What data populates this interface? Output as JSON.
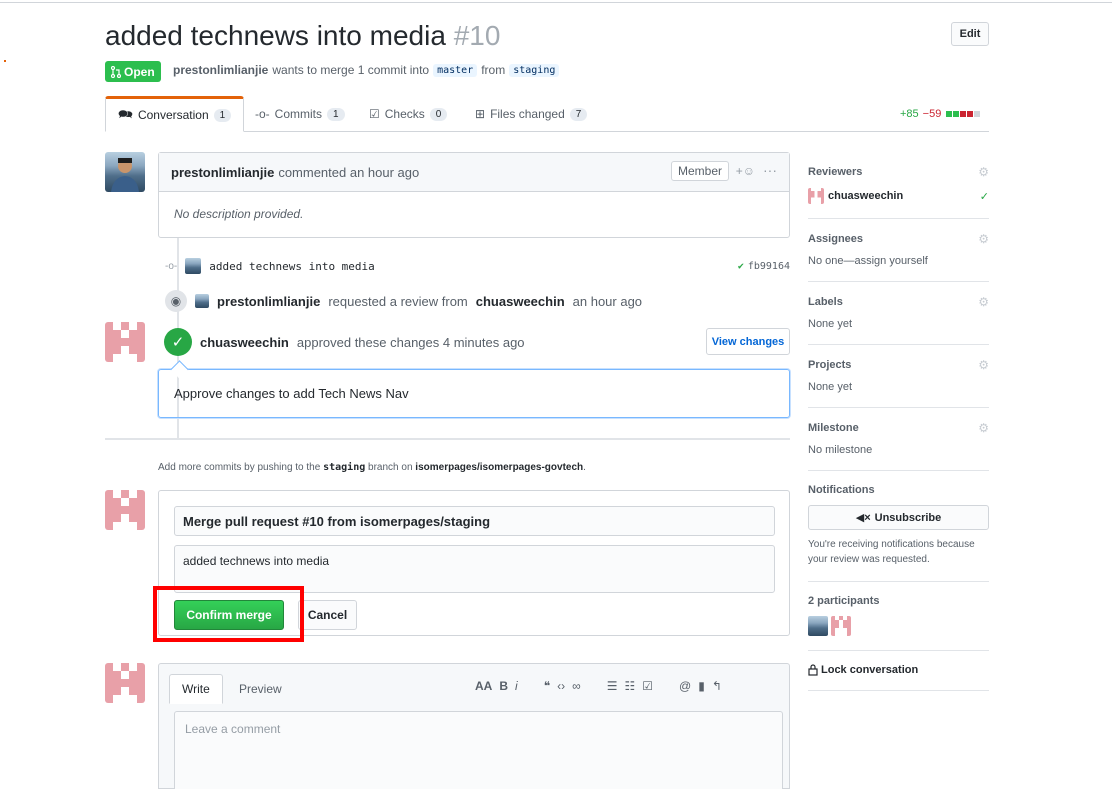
{
  "pr": {
    "title": "added technews into media",
    "number": "#10",
    "state": "Open",
    "author": "prestonlimlianjie",
    "merge_text": "wants to merge 1 commit into",
    "base_branch": "master",
    "from_text": "from",
    "head_branch": "staging",
    "edit_label": "Edit"
  },
  "tabs": [
    {
      "label": "Conversation",
      "count": "1",
      "icon": "comment-discussion-icon"
    },
    {
      "label": "Commits",
      "count": "1",
      "icon": "git-commit-icon"
    },
    {
      "label": "Checks",
      "count": "0",
      "icon": "checklist-icon"
    },
    {
      "label": "Files changed",
      "count": "7",
      "icon": "file-diff-icon"
    }
  ],
  "diffstat": {
    "additions": "+85",
    "deletions": "−59"
  },
  "comment": {
    "author": "prestonlimlianjie",
    "action": "commented an hour ago",
    "badge": "Member",
    "body": "No description provided."
  },
  "timeline": {
    "commit_message": "added technews into media",
    "commit_sha": "fb99164",
    "review_request": {
      "actor": "prestonlimlianjie",
      "text": "requested a review from",
      "target": "chuasweechin",
      "time": "an hour ago"
    },
    "approval": {
      "actor": "chuasweechin",
      "text": "approved these changes 4 minutes ago",
      "button": "View changes"
    },
    "approval_comment": "Approve changes to add Tech News Nav"
  },
  "merge": {
    "hint_prefix": "Add more commits by pushing to the",
    "hint_branch": "staging",
    "hint_middle": "branch on",
    "hint_repo": "isomerpages/isomerpages-govtech",
    "hint_suffix": ".",
    "title_value": "Merge pull request #10 from isomerpages/staging",
    "body_value": "added technews into media",
    "confirm_label": "Confirm merge",
    "cancel_label": "Cancel"
  },
  "composer": {
    "write_tab": "Write",
    "preview_tab": "Preview",
    "placeholder": "Leave a comment",
    "toolbar": [
      "AA",
      "B",
      "i",
      "❝",
      "‹›",
      "∞",
      "☰",
      "☷",
      "☑",
      "@",
      "▮",
      "↰"
    ]
  },
  "sidebar": {
    "reviewers": {
      "title": "Reviewers",
      "value": "chuasweechin"
    },
    "assignees": {
      "title": "Assignees",
      "value": "No one—assign yourself"
    },
    "labels": {
      "title": "Labels",
      "value": "None yet"
    },
    "projects": {
      "title": "Projects",
      "value": "None yet"
    },
    "milestone": {
      "title": "Milestone",
      "value": "No milestone"
    },
    "notifications": {
      "title": "Notifications",
      "button": "Unsubscribe",
      "note": "You're receiving notifications because your review was requested."
    },
    "participants": {
      "title": "2 participants"
    },
    "lock": "Lock conversation"
  },
  "colors": {
    "accent": "#e36209",
    "green": "#28a745",
    "link": "#0366d6",
    "highlight": "#ff0000"
  }
}
